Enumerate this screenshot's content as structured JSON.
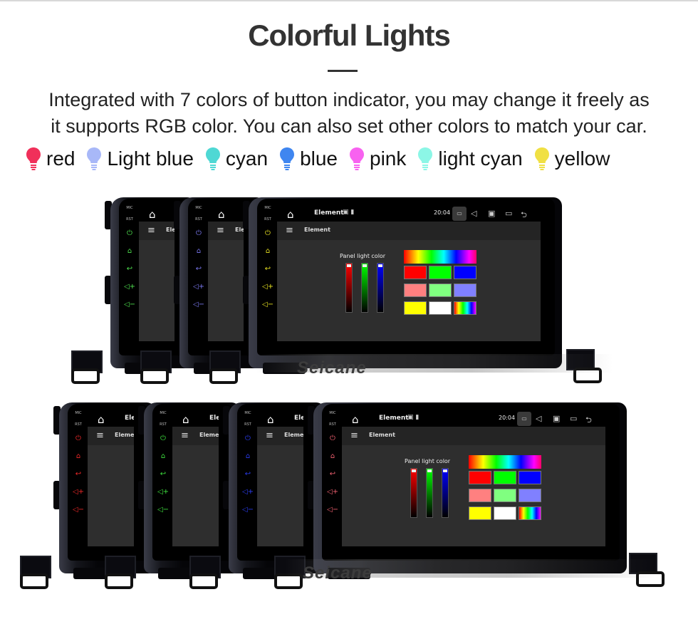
{
  "header": {
    "title": "Colorful Lights",
    "description_line1": "Integrated with 7 colors of button indicator, you may change it freely as",
    "description_line2": "it supports RGB color. You can also set other colors to match your car."
  },
  "legend": [
    {
      "label": "red",
      "color": "#f0305a",
      "icon": "bulb-icon"
    },
    {
      "label": "Light blue",
      "color": "#a8b8f8",
      "icon": "bulb-icon"
    },
    {
      "label": "cyan",
      "color": "#4fd8d4",
      "icon": "bulb-icon"
    },
    {
      "label": "blue",
      "color": "#3f86f0",
      "icon": "bulb-icon"
    },
    {
      "label": "pink",
      "color": "#f862f0",
      "icon": "bulb-icon"
    },
    {
      "label": "light cyan",
      "color": "#8cf6e6",
      "icon": "bulb-icon"
    },
    {
      "label": "yellow",
      "color": "#f0e044",
      "icon": "bulb-icon"
    }
  ],
  "device": {
    "status_title": "Element",
    "app_bar_title": "Element",
    "time": "20:04",
    "mic_label": "MIC",
    "rst_label": "RST",
    "panel_light_label": "Panel light color",
    "watermark": "Seicane"
  },
  "top_row_button_colors": [
    "#4ee04e",
    "#7a78f0",
    "#e6e020"
  ],
  "bottom_row_button_colors": [
    "#f02828",
    "#3ee03e",
    "#2a3cf0",
    "#f06070"
  ],
  "swatches": [
    "#ff0000",
    "#00ff00",
    "#0000ff",
    "#ff8080",
    "#80ff80",
    "#8080ff",
    "#ffff00",
    "#ffffff",
    "rainbow"
  ]
}
